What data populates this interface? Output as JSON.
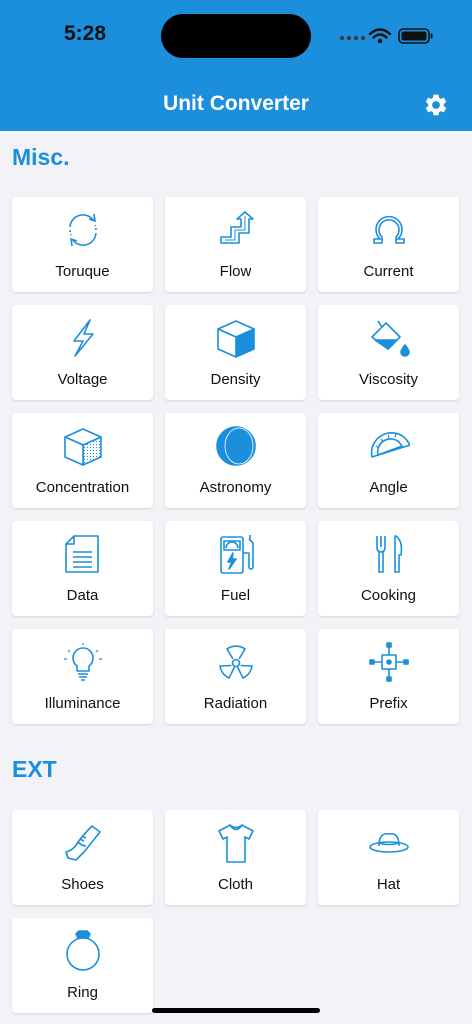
{
  "status_bar": {
    "time": "5:28"
  },
  "nav": {
    "title": "Unit Converter",
    "settings_icon": "gear-icon"
  },
  "sections": [
    {
      "title": "Misc.",
      "items": [
        {
          "label": "Toruque",
          "icon": "rotation-arrows-icon"
        },
        {
          "label": "Flow",
          "icon": "flow-pipe-icon"
        },
        {
          "label": "Current",
          "icon": "ohm-icon"
        },
        {
          "label": "Voltage",
          "icon": "lightning-icon"
        },
        {
          "label": "Density",
          "icon": "cube-icon"
        },
        {
          "label": "Viscosity",
          "icon": "paint-bucket-drop-icon"
        },
        {
          "label": "Concentration",
          "icon": "dotted-cube-icon"
        },
        {
          "label": "Astronomy",
          "icon": "moon-icon"
        },
        {
          "label": "Angle",
          "icon": "protractor-icon"
        },
        {
          "label": "Data",
          "icon": "document-icon"
        },
        {
          "label": "Fuel",
          "icon": "fuel-pump-icon"
        },
        {
          "label": "Cooking",
          "icon": "fork-knife-icon"
        },
        {
          "label": "Illuminance",
          "icon": "light-bulb-icon"
        },
        {
          "label": "Radiation",
          "icon": "radiation-icon"
        },
        {
          "label": "Prefix",
          "icon": "chip-icon"
        }
      ]
    },
    {
      "title": "EXT",
      "items": [
        {
          "label": "Shoes",
          "icon": "shoe-icon"
        },
        {
          "label": "Cloth",
          "icon": "tshirt-icon"
        },
        {
          "label": "Hat",
          "icon": "hat-icon"
        },
        {
          "label": "Ring",
          "icon": "ring-icon"
        }
      ]
    }
  ],
  "colors": {
    "accent": "#1B8FDB",
    "background": "#F2F2F7",
    "tile": "#FFFFFF"
  }
}
